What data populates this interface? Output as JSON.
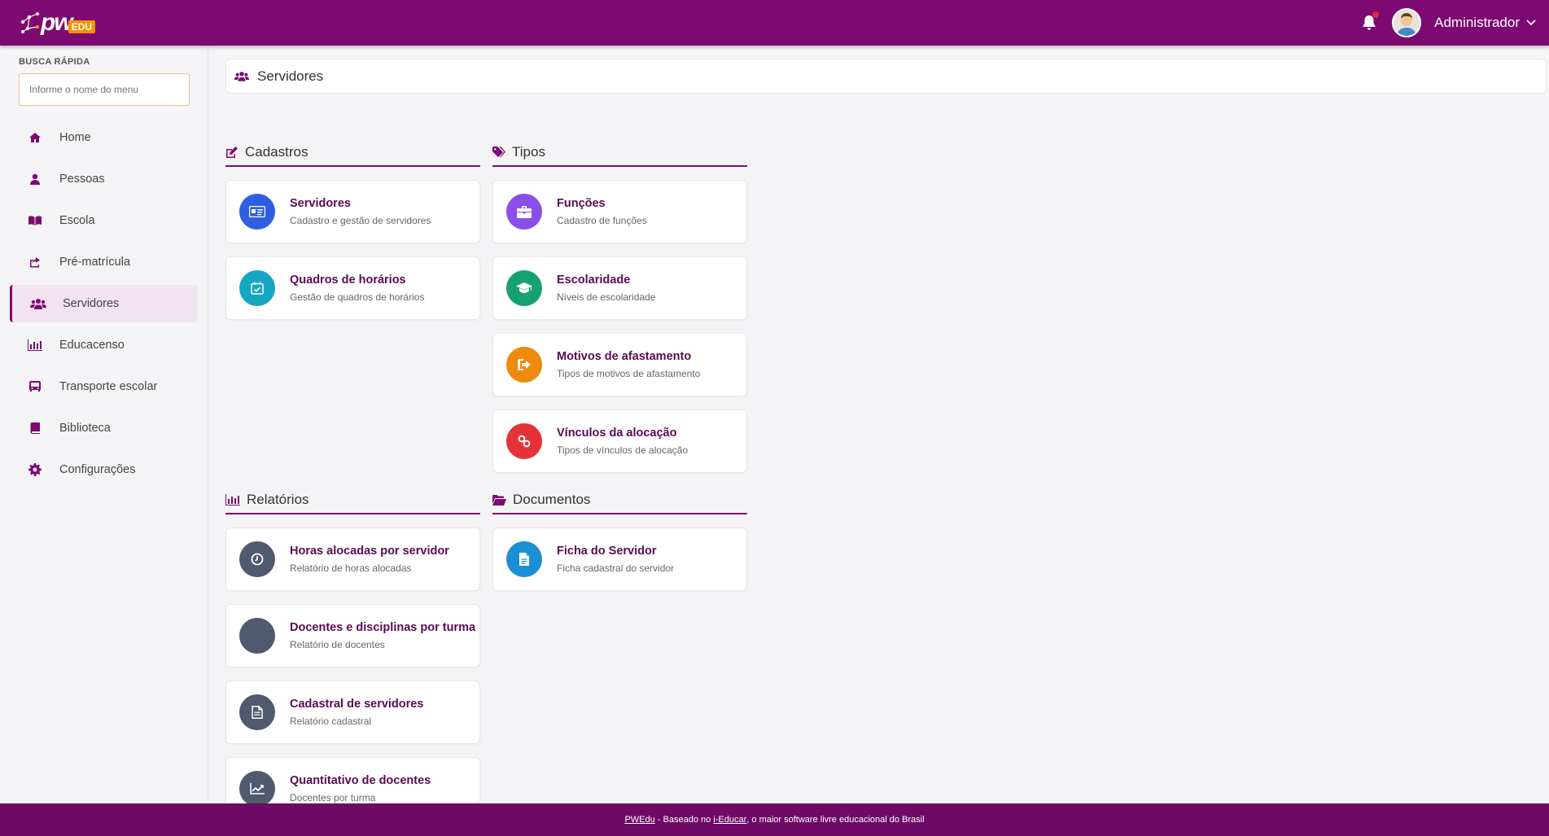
{
  "topbar": {
    "logo_main": "pw",
    "logo_sub": "EDU",
    "user_name": "Administrador"
  },
  "sidebar": {
    "quick_label": "BUSCA RÁPIDA",
    "search_placeholder": "Informe o nome do menu",
    "items": [
      {
        "label": "Home",
        "icon": "home-icon"
      },
      {
        "label": "Pessoas",
        "icon": "user-icon"
      },
      {
        "label": "Escola",
        "icon": "book-open-icon"
      },
      {
        "label": "Pré-matrícula",
        "icon": "share-square-icon"
      },
      {
        "label": "Servidores",
        "icon": "users-icon",
        "active": true
      },
      {
        "label": "Educacenso",
        "icon": "bar-chart-icon"
      },
      {
        "label": "Transporte escolar",
        "icon": "bus-icon"
      },
      {
        "label": "Biblioteca",
        "icon": "book-icon"
      },
      {
        "label": "Configurações",
        "icon": "gear-icon"
      }
    ]
  },
  "page": {
    "title": "Servidores"
  },
  "sections": {
    "cadastros": {
      "title": "Cadastros",
      "cards": [
        {
          "title": "Servidores",
          "sub": "Cadastro e gestão de servidores",
          "color": "#2f5fe0"
        },
        {
          "title": "Quadros de horários",
          "sub": "Gestão de quadros de horários",
          "color": "#17a6c2"
        }
      ]
    },
    "tipos": {
      "title": "Tipos",
      "cards": [
        {
          "title": "Funções",
          "sub": "Cadastro de funções",
          "color": "#8a4fe8"
        },
        {
          "title": "Escolaridade",
          "sub": "Níveis de escolaridade",
          "color": "#16a173"
        },
        {
          "title": "Motivos de afastamento",
          "sub": "Tipos de motivos de afastamento",
          "color": "#ee8a0c"
        },
        {
          "title": "Vínculos da alocação",
          "sub": "Tipos de vínculos de alocação",
          "color": "#e53238"
        }
      ]
    },
    "relatorios": {
      "title": "Relatórios",
      "cards": [
        {
          "title": "Horas alocadas por servidor",
          "sub": "Relatório de horas alocadas",
          "color": "#505a6e"
        },
        {
          "title": "Docentes e disciplinas por turma",
          "sub": "Relatório de docentes",
          "color": "#505a6e"
        },
        {
          "title": "Cadastral de servidores",
          "sub": "Relatório cadastral",
          "color": "#505a6e"
        },
        {
          "title": "Quantitativo de docentes",
          "sub": "Docentes por turma",
          "color": "#505a6e"
        }
      ]
    },
    "documentos": {
      "title": "Documentos",
      "cards": [
        {
          "title": "Ficha do Servidor",
          "sub": "Ficha cadastral do servidor",
          "color": "#1b8fd6"
        }
      ]
    }
  },
  "footer": {
    "link1": "PWEdu",
    "text1": " - Baseado no ",
    "link2": "i-Educar",
    "text2": ", o maior software livre educacional do Brasil"
  }
}
